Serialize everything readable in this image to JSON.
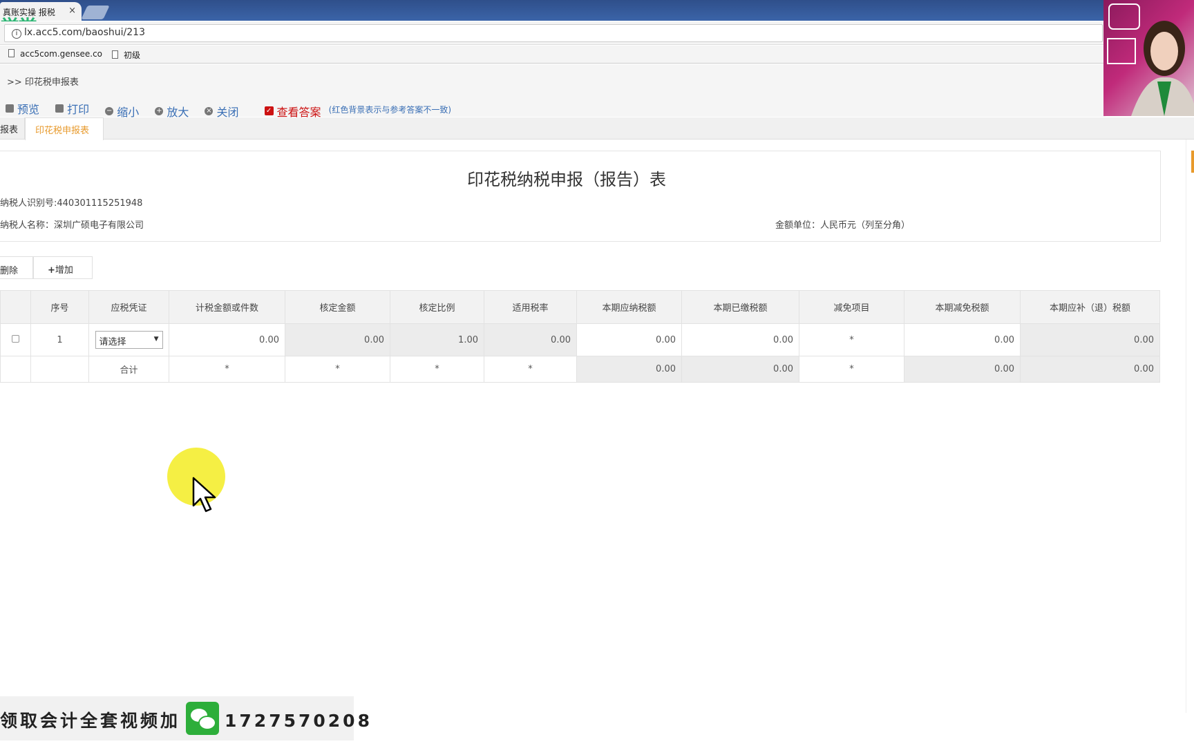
{
  "browser": {
    "tab_title": "真账实操 报税",
    "tab_close": "×",
    "logo_text": "学堂",
    "url": "lx.acc5.com/baoshui/213",
    "bookmarks": [
      "acc5com.gensee.co",
      "初级"
    ]
  },
  "page": {
    "breadcrumb": ">> 印花税申报表",
    "toolbar": {
      "preview": "预览",
      "print": "打印",
      "zoom_out": "缩小",
      "zoom_in": "放大",
      "close": "关闭",
      "show_answer": "查看答案",
      "answer_note": "(红色背景表示与参考答案不一致)"
    },
    "tabs": [
      "报表",
      "印花税申报表"
    ],
    "form": {
      "title": "印花税纳税申报（报告）表",
      "taxpayer_id": "纳税人识别号:440301115251948",
      "taxpayer_name": "纳税人名称：深圳广硕电子有限公司",
      "amount_unit": "金额单位：人民币元（列至分角）"
    },
    "actions": {
      "delete": "删除",
      "add": "增加"
    },
    "table": {
      "headers": [
        "",
        "序号",
        "应税凭证",
        "计税金额或件数",
        "核定金额",
        "核定比例",
        "适用税率",
        "本期应纳税额",
        "本期已缴税额",
        "减免项目",
        "本期减免税额",
        "本期应补（退）税额"
      ],
      "row": {
        "index": "1",
        "select": "请选择",
        "tax_amount": "0.00",
        "verified_amount": "0.00",
        "verified_ratio": "1.00",
        "rate": "0.00",
        "payable": "0.00",
        "paid": "0.00",
        "relief_item": "*",
        "relief_amount": "0.00",
        "supplement": "0.00"
      },
      "total": {
        "label": "合计",
        "tax_amount": "*",
        "verified_amount": "*",
        "verified_ratio": "*",
        "rate": "*",
        "payable": "0.00",
        "paid": "0.00",
        "relief_item": "*",
        "relief_amount": "0.00",
        "supplement": "0.00"
      }
    }
  },
  "overlay": {
    "promo_text": "领取会计全套视频加",
    "phone": "1727570208"
  }
}
